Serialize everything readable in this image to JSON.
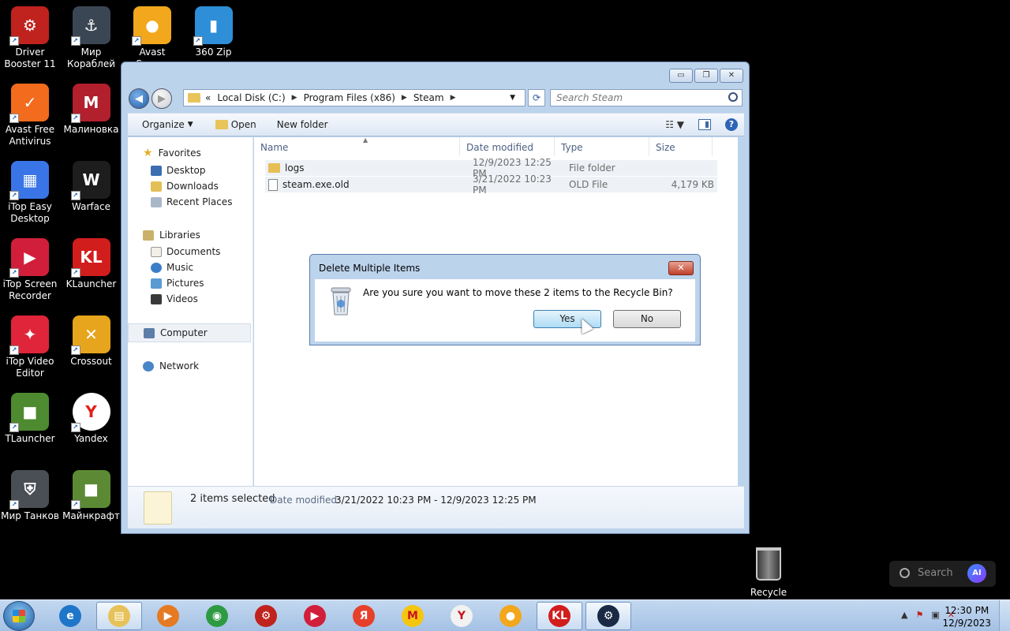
{
  "desktop": {
    "icons": [
      {
        "label": "Driver\nBooster 11",
        "color": "#c0221e",
        "glyph": "⚙"
      },
      {
        "label": "Мир\nКораблей",
        "color": "#3a4654",
        "glyph": "⚓"
      },
      {
        "label": "Avast Secure",
        "color": "#f2a71c",
        "glyph": "●"
      },
      {
        "label": "360 Zip",
        "color": "#2e8fd8",
        "glyph": "▮"
      },
      {
        "label": "Avast Free\nAntivirus",
        "color": "#f36b1c",
        "glyph": "✓"
      },
      {
        "label": "Малиновка",
        "color": "#b21f2d",
        "glyph": "M"
      },
      {
        "label": "iTop Easy\nDesktop",
        "color": "#3975e6",
        "glyph": "▦"
      },
      {
        "label": "Warface",
        "color": "#1d1d1d",
        "glyph": "W"
      },
      {
        "label": "iTop Screen\nRecorder",
        "color": "#d11f3b",
        "glyph": "▶"
      },
      {
        "label": "KLauncher",
        "color": "#d21d1d",
        "glyph": "KL"
      },
      {
        "label": "iTop Video\nEditor",
        "color": "#e0243a",
        "glyph": "✦"
      },
      {
        "label": "Crossout",
        "color": "#e6a51c",
        "glyph": "✕"
      },
      {
        "label": "TLauncher",
        "color": "#4e8a2f",
        "glyph": "■"
      },
      {
        "label": "Yandex",
        "color": "#ffffff",
        "glyph": "Y"
      },
      {
        "label": "Мир Танков",
        "color": "#4a4f55",
        "glyph": "⛨"
      },
      {
        "label": "Майнкрафт",
        "color": "#5c8a34",
        "glyph": "■"
      }
    ],
    "recycle_bin_label": "Recycle Bin",
    "search_widget": {
      "placeholder": "Search",
      "ai_label": "AI"
    }
  },
  "explorer": {
    "caption_buttons": [
      "▭",
      "❐",
      "✕"
    ],
    "address": {
      "prefix": "«",
      "crumbs": [
        "Local Disk (C:)",
        "Program Files (x86)",
        "Steam"
      ]
    },
    "search_placeholder": "Search Steam",
    "toolbar": {
      "organize_label": "Organize",
      "open_label": "Open",
      "new_folder_label": "New folder"
    },
    "nav": {
      "favorites": {
        "label": "Favorites",
        "items": [
          "Desktop",
          "Downloads",
          "Recent Places"
        ]
      },
      "libraries": {
        "label": "Libraries",
        "items": [
          "Documents",
          "Music",
          "Pictures",
          "Videos"
        ]
      },
      "computer": "Computer",
      "network": "Network"
    },
    "columns": [
      "Name",
      "Date modified",
      "Type",
      "Size"
    ],
    "files": [
      {
        "name": "logs",
        "date": "12/9/2023 12:25 PM",
        "type": "File folder",
        "size": ""
      },
      {
        "name": "steam.exe.old",
        "date": "3/21/2022 10:23 PM",
        "type": "OLD File",
        "size": "4,179 KB"
      }
    ],
    "details": {
      "count": "2 items selected",
      "date_label": "Date modified:",
      "date_value": "3/21/2022 10:23 PM - 12/9/2023 12:25 PM"
    }
  },
  "dialog": {
    "title": "Delete Multiple Items",
    "message": "Are you sure you want to move these 2 items to the Recycle Bin?",
    "yes_label": "Yes",
    "no_label": "No"
  },
  "taskbar": {
    "apps": [
      {
        "name": "internet-explorer",
        "color": "#1f76c9",
        "glyph": "e"
      },
      {
        "name": "file-explorer",
        "color": "#e7c25a",
        "glyph": "▤"
      },
      {
        "name": "media-player",
        "color": "#e57a22",
        "glyph": "▶"
      },
      {
        "name": "chrome",
        "color": "#2e9b43",
        "glyph": "◉"
      },
      {
        "name": "driver-booster",
        "color": "#c0221e",
        "glyph": "⚙"
      },
      {
        "name": "itop-recorder",
        "color": "#d11f3b",
        "glyph": "▶"
      },
      {
        "name": "yandex-browser",
        "color": "#e6402a",
        "glyph": "Я"
      },
      {
        "name": "market",
        "color": "#f6c50f",
        "glyph": "M"
      },
      {
        "name": "yandex",
        "color": "#f2f2f2",
        "glyph": "Y"
      },
      {
        "name": "avast-secure",
        "color": "#f2a71c",
        "glyph": "●"
      },
      {
        "name": "klauncher",
        "color": "#d21d1d",
        "glyph": "KL"
      },
      {
        "name": "steam",
        "color": "#1b2a44",
        "glyph": "⚙"
      }
    ],
    "clock_time": "12:30 PM",
    "clock_date": "12/9/2023"
  }
}
